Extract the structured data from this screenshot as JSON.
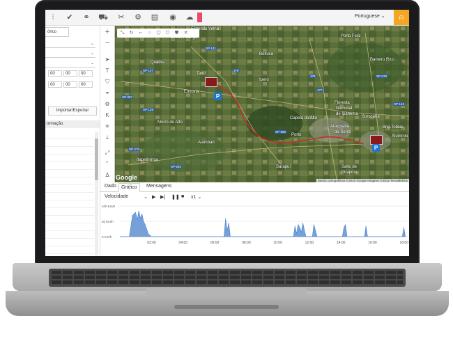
{
  "toolbar": {
    "icons": [
      "chart-icon",
      "check-icon",
      "binoculars-icon",
      "car-icon",
      "tools-icon",
      "settings-icon",
      "window-icon",
      "camera-icon",
      "cloud-icon"
    ],
    "language": "Portuguese",
    "accent": "#f5a623"
  },
  "sidebar": {
    "tab_label": "órico",
    "time_values": [
      "00",
      "00",
      "00"
    ],
    "import_button": "Importar/Exportar",
    "info_header": "ormação"
  },
  "map": {
    "towns": [
      "Fazenda Velha",
      "Cesário Lange",
      "Porto Feliz",
      "Quadra",
      "Boituva",
      "Barreiro Rico",
      "Tatuí",
      "Iperó",
      "Enxovia",
      "Floresta",
      "Nacional",
      "de Ipanema",
      "Sorocaba",
      "Morro do Alto",
      "Capela do Alto",
      "Araçoiaba",
      "da Serra",
      "Porto",
      "Alambari",
      "Itapetininga",
      "Sarapuí",
      "Salto de",
      "Pirapora",
      "Brig.Tobias",
      "Alumínio"
    ],
    "road_labels": [
      "SP-127",
      "SP-141",
      "SP-280",
      "SP-129",
      "SP-270",
      "SP-264",
      "SP-097",
      "SP-079",
      "SP-143",
      "379",
      "478",
      "477"
    ],
    "google_label": "Google",
    "attribution": "Dados cartográficos ©2022 Google Imagens ©2022 TerraMetrics",
    "parking_label": "P",
    "route_color": "#c0302a"
  },
  "tabs": [
    "Dado",
    "Gráfico",
    "Mensagens"
  ],
  "controls": {
    "metric": "Velocidade",
    "speed": "x1"
  },
  "chart_data": {
    "type": "area",
    "ylabel": "",
    "yticks": [
      "100 Km/h",
      "50 Km/h",
      "0 Km/h"
    ],
    "ylim": [
      0,
      100
    ],
    "xticks": [
      "02:00",
      "04:00",
      "06:00",
      "08:00",
      "10:00",
      "12:00",
      "14:00",
      "16:00",
      "18:00"
    ],
    "x": [
      0.0,
      0.6,
      0.8,
      1.0,
      1.1,
      1.2,
      1.3,
      1.4,
      1.5,
      1.6,
      1.7,
      1.8,
      2.0,
      6.6,
      6.7,
      6.8,
      6.9,
      7.0,
      11.0,
      11.1,
      11.2,
      11.3,
      11.4,
      11.5,
      11.6,
      11.7,
      11.8,
      11.9,
      12.2,
      12.3,
      12.4,
      12.5,
      14.1,
      14.2,
      14.3,
      14.4,
      15.5,
      15.6,
      15.7,
      17.9,
      18.0,
      18.1
    ],
    "values": [
      0,
      0,
      70,
      80,
      55,
      85,
      60,
      75,
      50,
      40,
      25,
      10,
      0,
      0,
      60,
      20,
      45,
      0,
      0,
      35,
      10,
      40,
      30,
      15,
      45,
      20,
      0,
      0,
      0,
      40,
      20,
      0,
      0,
      30,
      40,
      0,
      0,
      35,
      0,
      0,
      30,
      0
    ],
    "series_color": "#3c78c8"
  }
}
